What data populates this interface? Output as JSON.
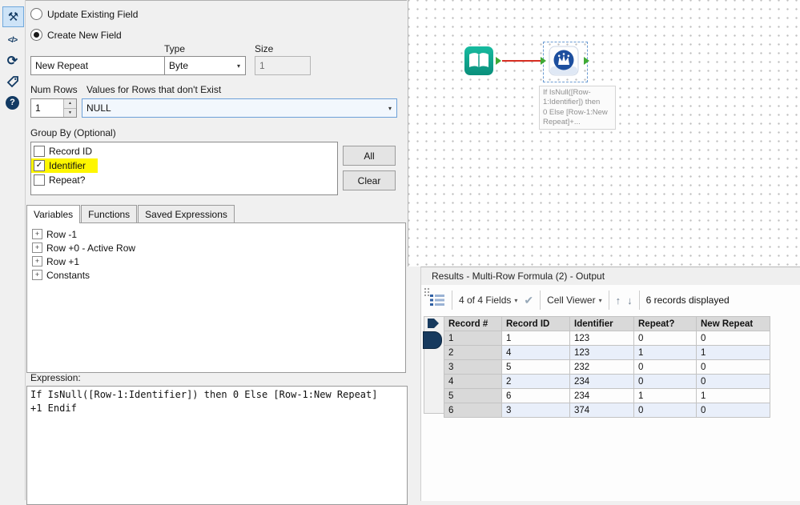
{
  "icons": {
    "wrench": "⚒",
    "code": "</>",
    "refresh": "⟳",
    "help": "?",
    "caret": "▾",
    "check": "✓",
    "apply_check": "✔",
    "up_arrow": "↑",
    "down_arrow": "↓",
    "spin_up": "▲",
    "spin_down": "▼",
    "expand": "+"
  },
  "config": {
    "radio_update_label": "Update Existing Field",
    "radio_create_label": "Create New Field",
    "field_name_value": "New Repeat",
    "type_label": "Type",
    "type_value": "Byte",
    "size_label": "Size",
    "size_value": "1",
    "num_rows_label": "Num Rows",
    "num_rows_value": "1",
    "values_label": "Values for Rows that don't Exist",
    "values_value": "NULL",
    "group_by_label": "Group By (Optional)",
    "group_items": [
      "Record ID",
      "Identifier",
      "Repeat?"
    ],
    "all_button": "All",
    "clear_button": "Clear",
    "tab_variables": "Variables",
    "tab_functions": "Functions",
    "tab_saved": "Saved Expressions",
    "tree_items": [
      "Row -1",
      "Row +0 - Active Row",
      "Row +1",
      "Constants"
    ],
    "expression_label": "Expression:",
    "expression_text": "If IsNull([Row-1:Identifier]) then 0 Else [Row-1:New Repeat]\n+1 Endif"
  },
  "canvas": {
    "annotation_text": "If IsNull([Row-\n1:Identifier]) then\n0 Else [Row-1:New\nRepeat]+..."
  },
  "results": {
    "title": "Results - Multi-Row Formula (2) - Output",
    "fields_button": "4 of 4 Fields",
    "cell_viewer_button": "Cell Viewer",
    "records_label": "6 records displayed",
    "table": {
      "columns": [
        "Record #",
        "Record ID",
        "Identifier",
        "Repeat?",
        "New Repeat"
      ],
      "rows": [
        [
          "1",
          "1",
          "123",
          "0",
          "0"
        ],
        [
          "2",
          "4",
          "123",
          "1",
          "1"
        ],
        [
          "3",
          "5",
          "232",
          "0",
          "0"
        ],
        [
          "4",
          "2",
          "234",
          "0",
          "0"
        ],
        [
          "5",
          "6",
          "234",
          "1",
          "1"
        ],
        [
          "6",
          "3",
          "374",
          "0",
          "0"
        ]
      ]
    }
  }
}
